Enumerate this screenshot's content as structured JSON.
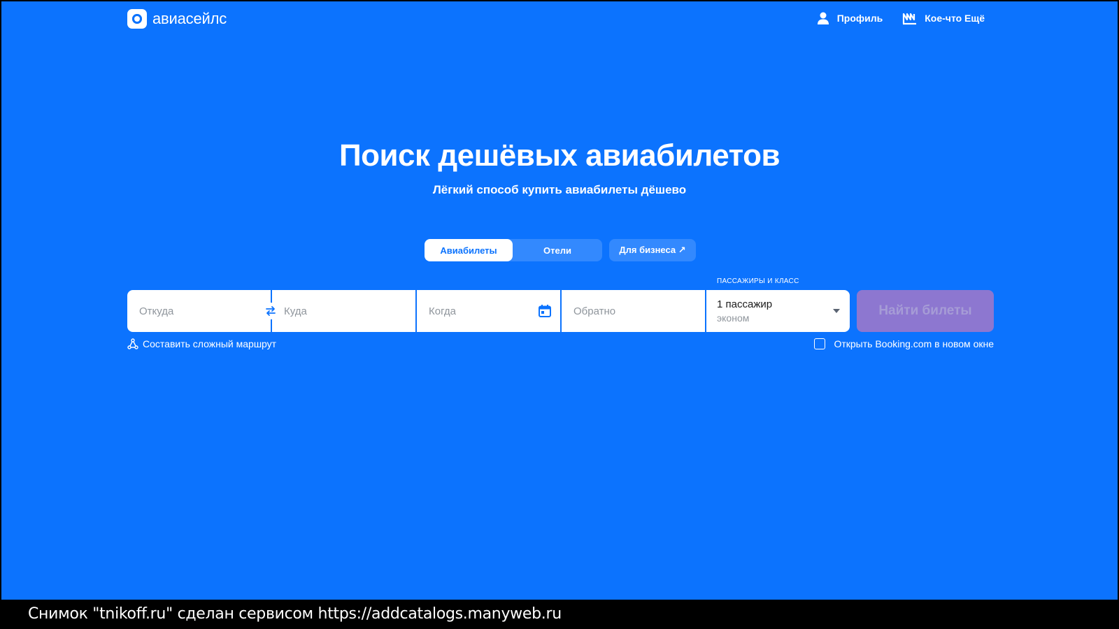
{
  "header": {
    "logo_text": "авиасейлс",
    "nav": [
      {
        "label": "Профиль",
        "icon": "user-icon"
      },
      {
        "label": "Кое-что Ещё",
        "icon": "extras-icon"
      }
    ]
  },
  "hero": {
    "title": "Поиск дешёвых авиабилетов",
    "subtitle": "Лёгкий способ купить авиабилеты дёшево"
  },
  "tabs": {
    "flights": "Авиабилеты",
    "hotels": "Отели",
    "business": "Для бизнеса ↗"
  },
  "search": {
    "from_placeholder": "Откуда",
    "to_placeholder": "Куда",
    "when_placeholder": "Когда",
    "back_placeholder": "Обратно",
    "passengers_label": "ПАССАЖИРЫ И КЛАСС",
    "passengers_value": "1 пассажир",
    "class_value": "эконом",
    "submit_label": "Найти билеты"
  },
  "options": {
    "complex_route": "Составить сложный маршрут",
    "booking_new_window": "Открыть Booking.com в новом окне"
  },
  "footer": {
    "caption": "Снимок \"tnikoff.ru\" сделан сервисом https://addcatalogs.manyweb.ru"
  },
  "colors": {
    "brand_blue": "#0c73fe",
    "search_button": "#8d77d0"
  }
}
